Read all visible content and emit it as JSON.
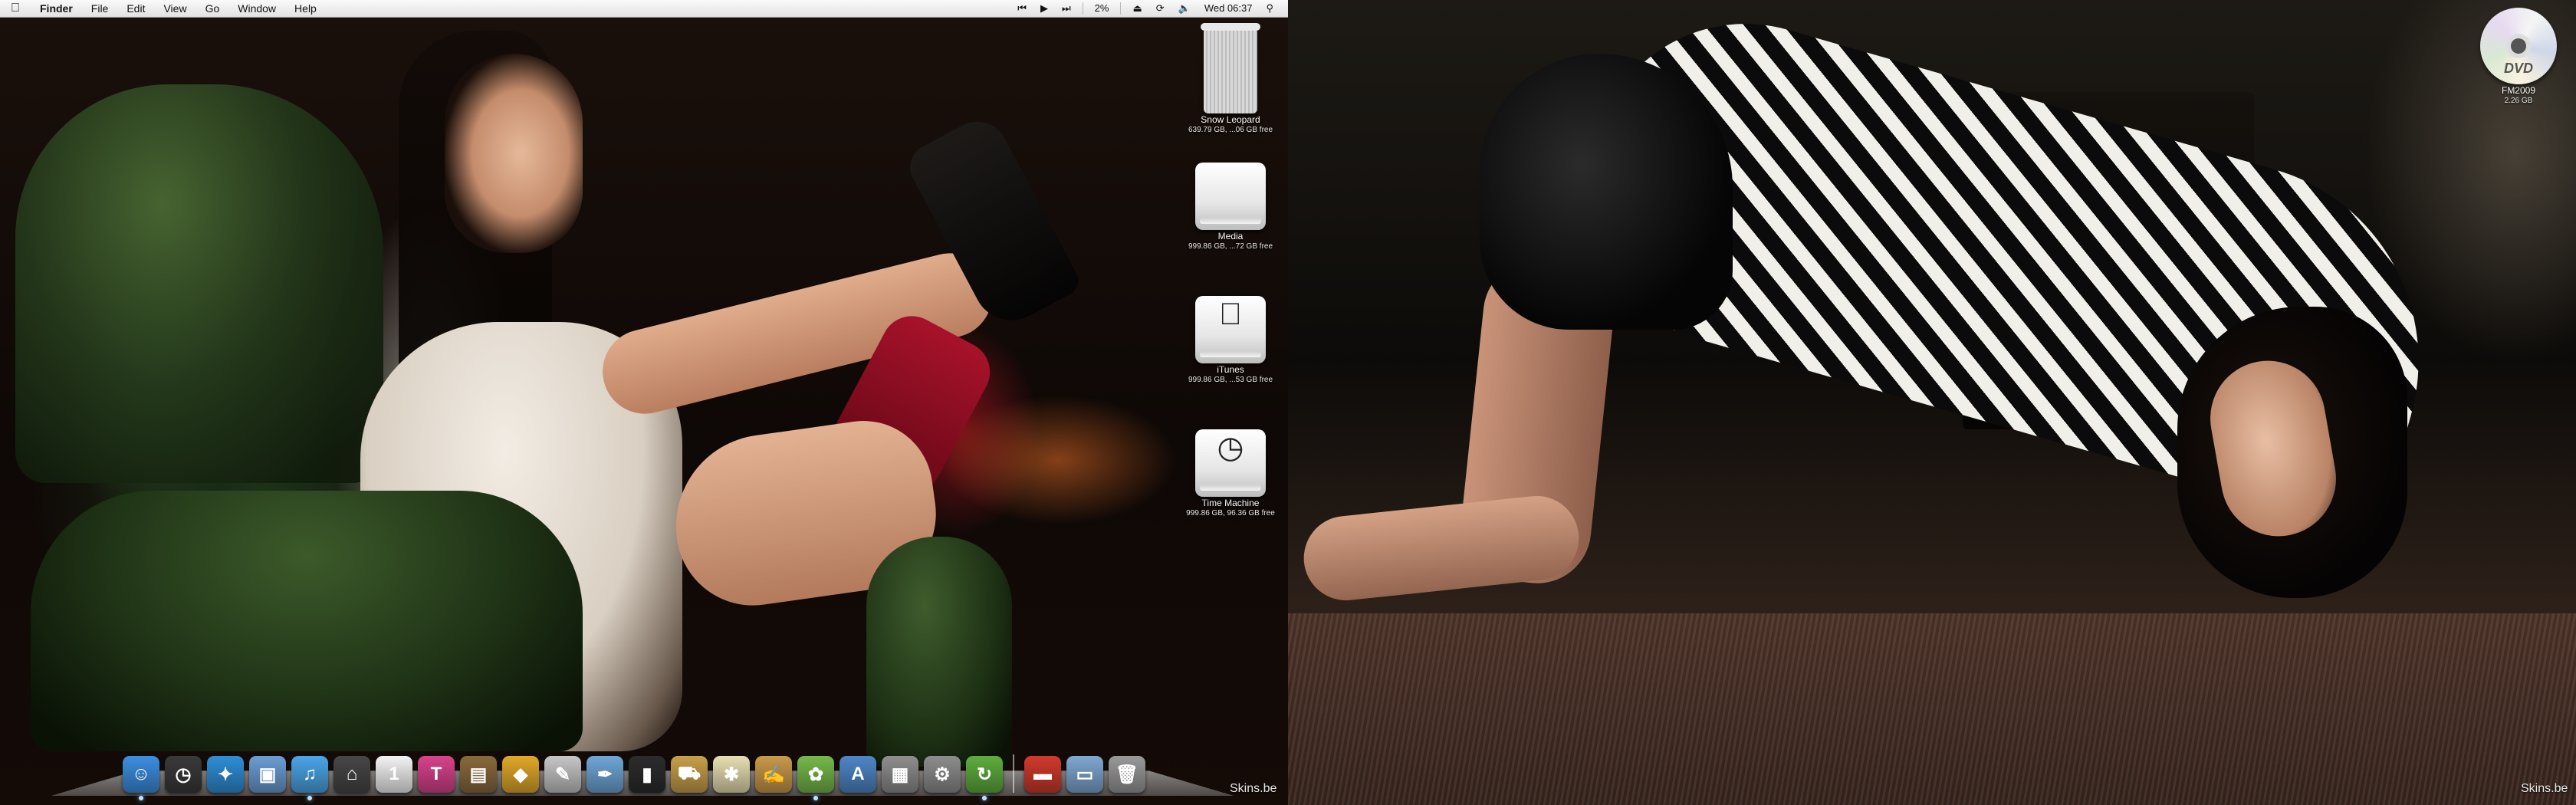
{
  "menubar": {
    "app_name": "Finder",
    "menus": [
      "File",
      "Edit",
      "View",
      "Go",
      "Window",
      "Help"
    ],
    "status": {
      "cpu_percent": "2%",
      "clock": "Wed 06:37"
    }
  },
  "desktop_icons": [
    {
      "name": "Snow Leopard",
      "info": "639.79 GB, ...06 GB free",
      "kind": "macpro"
    },
    {
      "name": "Media",
      "info": "999.86 GB, ...72 GB free",
      "kind": "drive"
    },
    {
      "name": "iTunes",
      "info": "999.86 GB, ...53 GB free",
      "kind": "drive-apple"
    },
    {
      "name": "Time Machine",
      "info": "999.86 GB, 96.36 GB free",
      "kind": "drive-timemachine"
    }
  ],
  "second_screen_icon": {
    "name": "FM2009",
    "info": "2.26 GB",
    "disc_label": "DVD"
  },
  "dock": {
    "apps": [
      {
        "name": "Finder",
        "color": "#3d8fe0",
        "glyph": "☺",
        "running": true
      },
      {
        "name": "Dashboard",
        "color": "#3a3a3a",
        "glyph": "◷",
        "running": false
      },
      {
        "name": "Safari",
        "color": "#2f8fd8",
        "glyph": "✦",
        "running": false
      },
      {
        "name": "Preview",
        "color": "#6c9ed6",
        "glyph": "▣",
        "running": false
      },
      {
        "name": "iTunes",
        "color": "#4ba6e8",
        "glyph": "♫",
        "running": true
      },
      {
        "name": "Spaces",
        "color": "#474747",
        "glyph": "⌂",
        "running": false
      },
      {
        "name": "iCal",
        "color": "#f4f4f4",
        "glyph": "1",
        "running": false
      },
      {
        "name": "Typinator",
        "color": "#d9438c",
        "glyph": "T",
        "running": false
      },
      {
        "name": "iPhoto",
        "color": "#8a6a3c",
        "glyph": "▤",
        "running": false
      },
      {
        "name": "Transmission",
        "color": "#e2a92a",
        "glyph": "◆",
        "running": false
      },
      {
        "name": "App",
        "color": "#c7c7c7",
        "glyph": "✎",
        "running": false
      },
      {
        "name": "TextEdit",
        "color": "#6fa7d8",
        "glyph": "✒",
        "running": false
      },
      {
        "name": "Terminal",
        "color": "#2c2c2c",
        "glyph": "▮",
        "running": false
      },
      {
        "name": "Transmit",
        "color": "#c9a04a",
        "glyph": "⛟",
        "running": false
      },
      {
        "name": "Bowtie",
        "color": "#e8dfb2",
        "glyph": "✱",
        "running": false
      },
      {
        "name": "Pages",
        "color": "#c99a4b",
        "glyph": "✍",
        "running": false
      },
      {
        "name": "Adium",
        "color": "#76b94a",
        "glyph": "✿",
        "running": true
      },
      {
        "name": "Xcode",
        "color": "#4f87c7",
        "glyph": "A",
        "running": false
      },
      {
        "name": "Photos",
        "color": "#8f8f8f",
        "glyph": "▦",
        "running": false
      },
      {
        "name": "System Preferences",
        "color": "#8e8e8e",
        "glyph": "⚙",
        "running": false
      },
      {
        "name": "Cycle",
        "color": "#5fae3e",
        "glyph": "↻",
        "running": true
      }
    ],
    "stacks": [
      {
        "name": "Toolbox",
        "color": "#d23a2c",
        "glyph": "▬"
      },
      {
        "name": "Documents",
        "color": "#7fa8d2",
        "glyph": "▭"
      },
      {
        "name": "Trash",
        "color": "#9a9a9a",
        "glyph": "🗑"
      }
    ]
  },
  "watermark_left": "Skins.be",
  "watermark_right": "Skins.be"
}
